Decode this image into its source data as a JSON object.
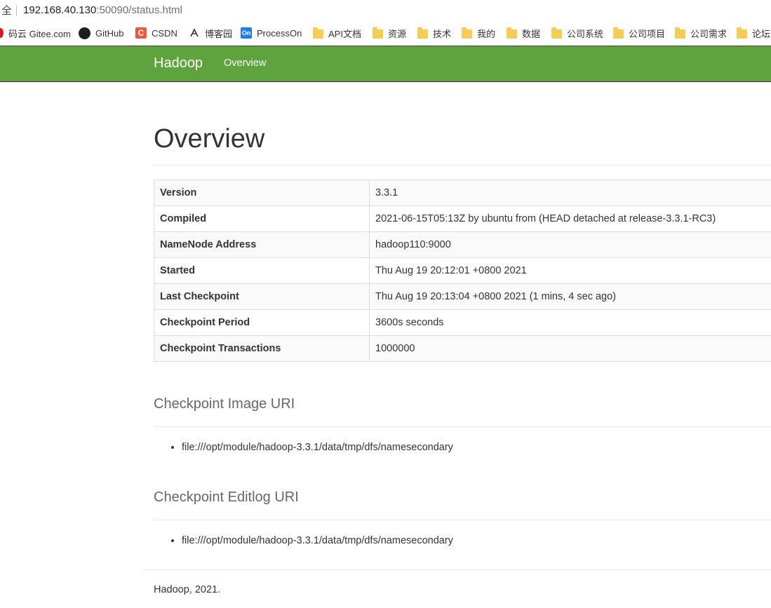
{
  "browser": {
    "security_text": "全",
    "url_host": "192.168.40.130",
    "url_path": ":50090/status.html",
    "bookmarks": [
      {
        "label": "码云 Gitee.com",
        "icon": "gitee-icon"
      },
      {
        "label": "GitHub",
        "icon": "github-icon"
      },
      {
        "label": "CSDN",
        "icon": "csdn-icon",
        "glyph": "C"
      },
      {
        "label": "博客园",
        "icon": "cnblogs-icon"
      },
      {
        "label": "ProcessOn",
        "icon": "processon-icon",
        "glyph": "On"
      },
      {
        "label": "API文档",
        "icon": "folder-icon"
      },
      {
        "label": "资源",
        "icon": "folder-icon"
      },
      {
        "label": "技术",
        "icon": "folder-icon"
      },
      {
        "label": "我的",
        "icon": "folder-icon"
      },
      {
        "label": "数据",
        "icon": "folder-icon"
      },
      {
        "label": "公司系统",
        "icon": "folder-icon"
      },
      {
        "label": "公司项目",
        "icon": "folder-icon"
      },
      {
        "label": "公司需求",
        "icon": "folder-icon"
      },
      {
        "label": "论坛",
        "icon": "folder-icon"
      }
    ]
  },
  "navbar": {
    "brand": "Hadoop",
    "link_overview": "Overview",
    "color": "#5fa33e"
  },
  "overview": {
    "title": "Overview",
    "rows": [
      {
        "label": "Version",
        "value": "3.3.1"
      },
      {
        "label": "Compiled",
        "value": "2021-06-15T05:13Z by ubuntu from (HEAD detached at release-3.3.1-RC3)"
      },
      {
        "label": "NameNode Address",
        "value": "hadoop110:9000"
      },
      {
        "label": "Started",
        "value": "Thu Aug 19 20:12:01 +0800 2021"
      },
      {
        "label": "Last Checkpoint",
        "value": "Thu Aug 19 20:13:04 +0800 2021 (1 mins, 4 sec ago)"
      },
      {
        "label": "Checkpoint Period",
        "value": "3600s seconds"
      },
      {
        "label": "Checkpoint Transactions",
        "value": "1000000"
      }
    ]
  },
  "image_uri": {
    "title": "Checkpoint Image URI",
    "items": [
      "file:///opt/module/hadoop-3.3.1/data/tmp/dfs/namesecondary"
    ]
  },
  "editlog_uri": {
    "title": "Checkpoint Editlog URI",
    "items": [
      "file:///opt/module/hadoop-3.3.1/data/tmp/dfs/namesecondary"
    ]
  },
  "footer": {
    "text": "Hadoop, 2021."
  }
}
